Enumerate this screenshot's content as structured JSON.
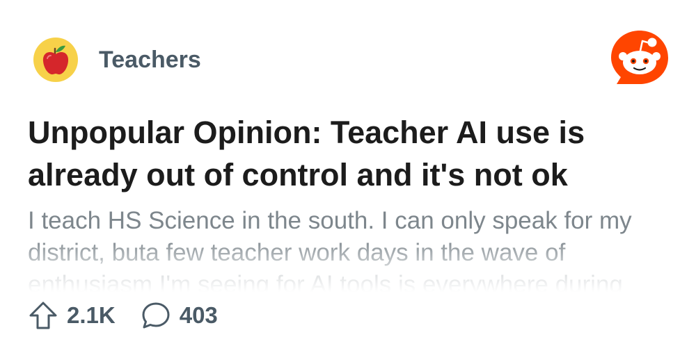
{
  "community": {
    "name": "Teachers",
    "avatar_icon": "apple-icon",
    "avatar_color": "#f7d149"
  },
  "brand": {
    "logo_icon": "reddit-logo-icon",
    "accent": "#ff4500"
  },
  "post": {
    "title": "Unpopular Opinion: Teacher AI use is already out of control and it's not ok",
    "body": "I teach HS Science in the south. I can only speak for my district, buta few teacher work days in the wave of enthusiasm I'm seeing for AI tools is everywhere during"
  },
  "stats": {
    "upvotes": "2.1K",
    "upvote_icon": "upvote-arrow-icon",
    "comments": "403",
    "comment_icon": "comment-bubble-icon"
  }
}
